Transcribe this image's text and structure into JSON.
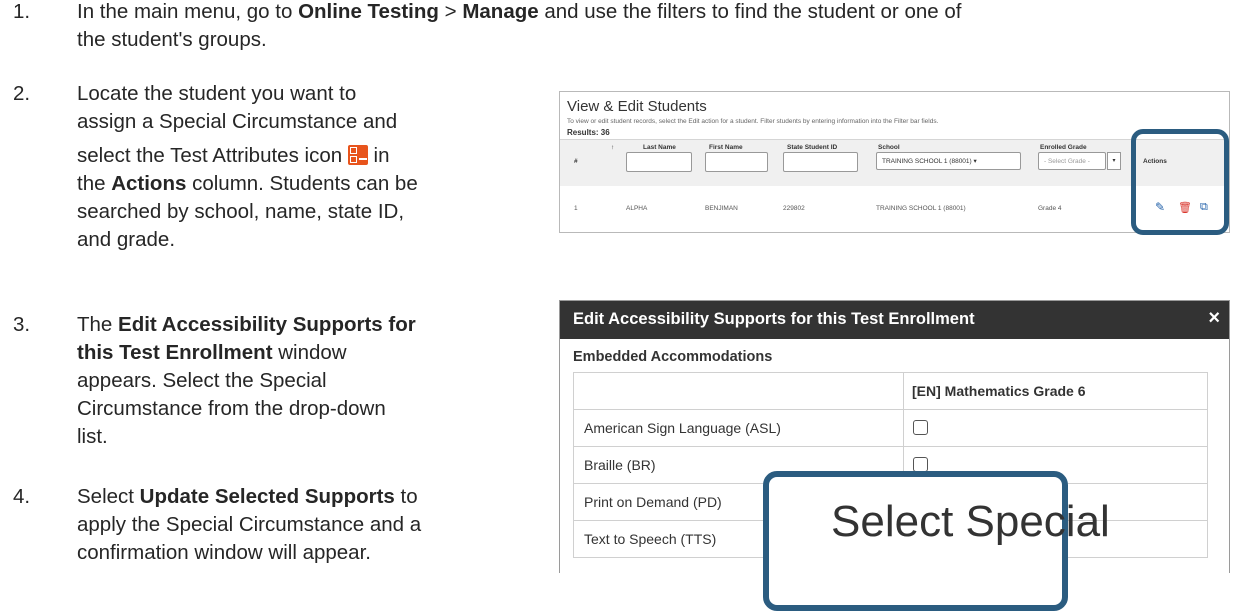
{
  "steps": [
    {
      "num": "1.",
      "lines": [
        {
          "parts": [
            {
              "t": "In the main menu, go to ",
              "b": false
            },
            {
              "t": "Online Testing",
              "b": true
            },
            {
              "t": " > ",
              "b": false
            },
            {
              "t": "Manage",
              "b": true
            },
            {
              "t": " and use the filters to find the student or one of",
              "b": false
            }
          ]
        },
        {
          "parts": [
            {
              "t": "the student's groups.",
              "b": false
            }
          ]
        }
      ]
    },
    {
      "num": "2.",
      "lines": [
        {
          "parts": [
            {
              "t": "Locate the student you want to",
              "b": false
            }
          ]
        },
        {
          "parts": [
            {
              "t": "assign a Special Circumstance and",
              "b": false
            }
          ]
        },
        {
          "parts": [
            {
              "t": "select the Test Attributes icon ",
              "b": false
            },
            {
              "t": "[icon]",
              "b": false,
              "icon": true
            },
            {
              "t": " in",
              "b": false
            }
          ]
        },
        {
          "parts": [
            {
              "t": "the ",
              "b": false
            },
            {
              "t": "Actions",
              "b": true
            },
            {
              "t": " column. Students can be",
              "b": false
            }
          ]
        },
        {
          "parts": [
            {
              "t": "searched by school, name, state ID,",
              "b": false
            }
          ]
        },
        {
          "parts": [
            {
              "t": "and grade.",
              "b": false
            }
          ]
        }
      ]
    },
    {
      "num": "3.",
      "lines": [
        {
          "parts": [
            {
              "t": "The ",
              "b": false
            },
            {
              "t": "Edit Accessibility Supports for",
              "b": true
            }
          ]
        },
        {
          "parts": [
            {
              "t": "this Test Enrollment",
              "b": true
            },
            {
              "t": " window",
              "b": false
            }
          ]
        },
        {
          "parts": [
            {
              "t": "appears. Select the Special",
              "b": false
            }
          ]
        },
        {
          "parts": [
            {
              "t": "Circumstance from the drop-down",
              "b": false
            }
          ]
        },
        {
          "parts": [
            {
              "t": "list.",
              "b": false
            }
          ]
        }
      ]
    },
    {
      "num": "4.",
      "lines": [
        {
          "parts": [
            {
              "t": "Select ",
              "b": false
            },
            {
              "t": "Update Selected Supports",
              "b": true
            },
            {
              "t": " to",
              "b": false
            }
          ]
        },
        {
          "parts": [
            {
              "t": "apply the Special Circumstance and a",
              "b": false
            }
          ]
        },
        {
          "parts": [
            {
              "t": "confirmation window will appear.",
              "b": false
            }
          ]
        }
      ]
    }
  ],
  "students_panel": {
    "title": "View & Edit Students",
    "subtitle": "To view or edit student records, select the Edit action for a student. Filter students by entering information into the Filter bar fields.",
    "results": "Results: 36",
    "headers": {
      "num": "#",
      "sort": "↑",
      "last": "Last Name",
      "first": "First Name",
      "ssid": "State Student ID",
      "school": "School",
      "grade": "Enrolled Grade",
      "actions": "Actions"
    },
    "school_filter": "TRAINING SCHOOL 1 (88001) ▾",
    "grade_filter": "- Select Grade -",
    "grade_caret": "▾",
    "row": {
      "num": "1",
      "last": "ALPHA",
      "first": "BENJIMAN",
      "ssid": "229802",
      "school": "TRAINING SCHOOL 1 (88001)",
      "grade": "Grade 4"
    }
  },
  "modal": {
    "title": "Edit Accessibility Supports for this Test Enrollment",
    "close": "×",
    "section": "Embedded Accommodations",
    "column_header": "[EN] Mathematics Grade 6",
    "rows": [
      "American Sign Language (ASL)",
      "Braille (BR)",
      "Print on Demand (PD)",
      "Text to Speech (TTS)"
    ],
    "callout": "Select Special"
  },
  "colors": {
    "highlight": "#2b5c80",
    "modal_header": "#333333",
    "icon_orange": "#e8541c",
    "icon_red": "#d9342b",
    "icon_blue": "#1f5fa8"
  }
}
